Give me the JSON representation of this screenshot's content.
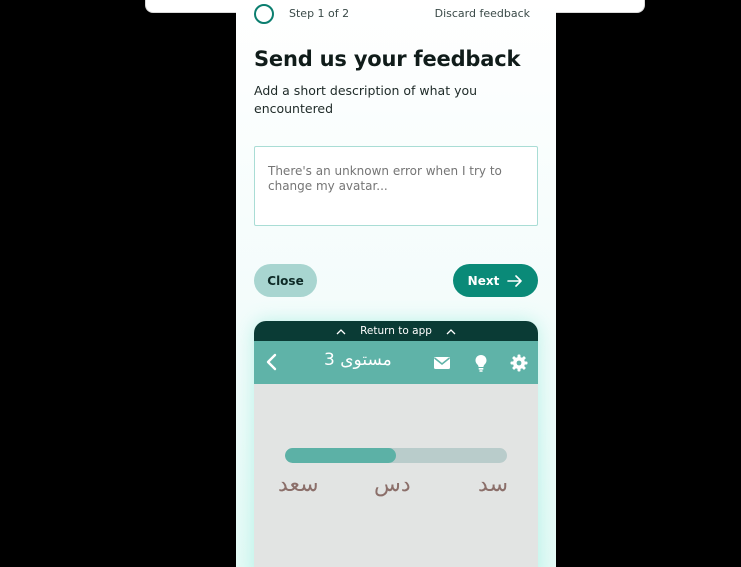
{
  "flow": {
    "step_label": "Step 1 of 2",
    "discard_label": "Discard feedback",
    "title": "Send us your feedback",
    "subtitle": "Add a short description of what you encountered",
    "textarea_placeholder": "There's an unknown error when I try to change my avatar...",
    "close_label": "Close",
    "next_label": "Next"
  },
  "preview": {
    "return_label": "Return to app",
    "app_title": "مستوى 3",
    "progress": 0.5,
    "words": [
      "سد",
      "دس",
      "سعد"
    ],
    "icons": [
      "back-chevron-icon",
      "mail-icon",
      "lightbulb-icon",
      "gear-icon"
    ]
  },
  "colors": {
    "accent": "#0a8a78",
    "close_button": "#a8d5d0",
    "app_header": "#5fb3a8",
    "return_bar": "#0a3b35",
    "progress_fill": "#5cb1a6",
    "progress_track": "#b9cccb"
  }
}
